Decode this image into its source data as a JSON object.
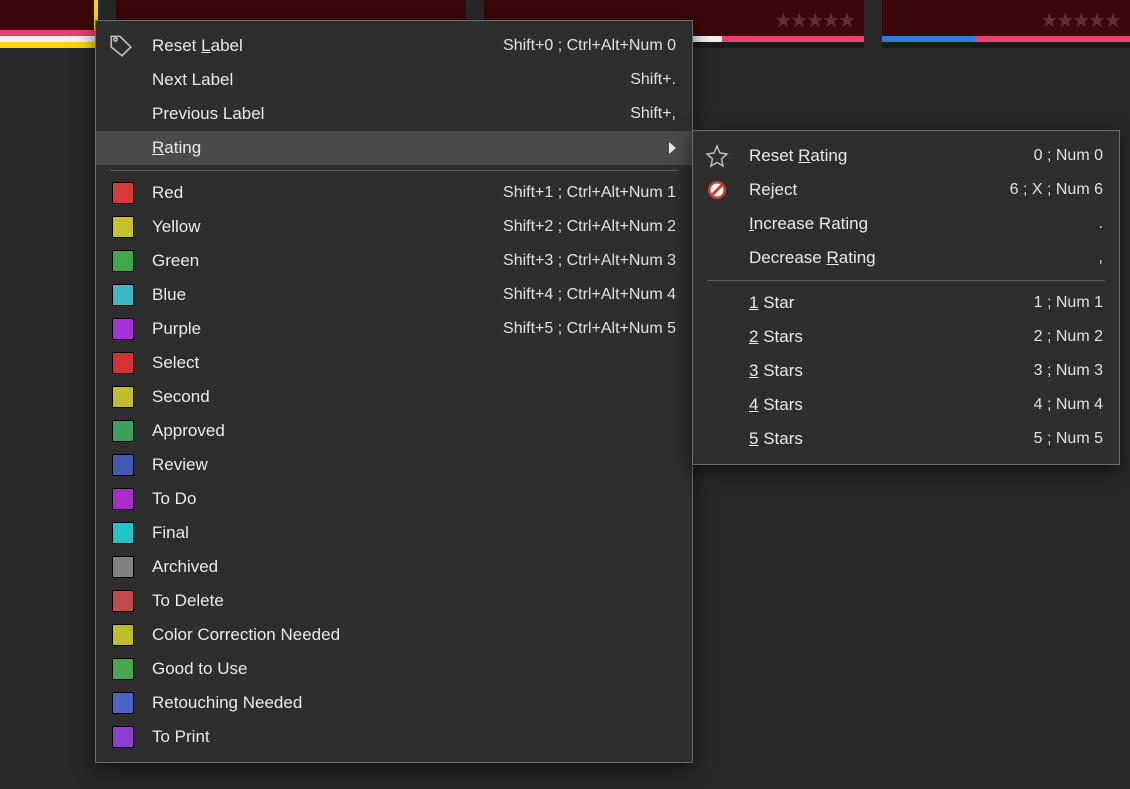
{
  "menu": {
    "header": [
      {
        "label": "Reset Label",
        "ul_start": 6,
        "shortcut": "Shift+0 ; Ctrl+Alt+Num 0"
      },
      {
        "label": "Next Label",
        "shortcut": "Shift+."
      },
      {
        "label": "Previous Label",
        "shortcut": "Shift+,"
      }
    ],
    "rating_label": "Rating",
    "colors": [
      {
        "name": "Red",
        "hex": "#d83a36",
        "shortcut": "Shift+1 ; Ctrl+Alt+Num 1"
      },
      {
        "name": "Yellow",
        "hex": "#c7c22a",
        "shortcut": "Shift+2 ; Ctrl+Alt+Num 2"
      },
      {
        "name": "Green",
        "hex": "#3fa64a",
        "shortcut": "Shift+3 ; Ctrl+Alt+Num 3"
      },
      {
        "name": "Blue",
        "hex": "#3fb8c4",
        "shortcut": "Shift+4 ; Ctrl+Alt+Num 4"
      },
      {
        "name": "Purple",
        "hex": "#a631d4",
        "shortcut": "Shift+5 ; Ctrl+Alt+Num 5"
      },
      {
        "name": "Select",
        "hex": "#d33232",
        "shortcut": ""
      },
      {
        "name": "Second",
        "hex": "#bfbf2a",
        "shortcut": ""
      },
      {
        "name": "Approved",
        "hex": "#3aa05a",
        "shortcut": ""
      },
      {
        "name": "Review",
        "hex": "#3f5bb0",
        "shortcut": ""
      },
      {
        "name": "To Do",
        "hex": "#a82ec7",
        "shortcut": ""
      },
      {
        "name": "Final",
        "hex": "#22c4cc",
        "shortcut": ""
      },
      {
        "name": "Archived",
        "hex": "#808080",
        "shortcut": ""
      },
      {
        "name": "To Delete",
        "hex": "#c24a4a",
        "shortcut": ""
      },
      {
        "name": "Color Correction Needed",
        "hex": "#bdbd27",
        "shortcut": ""
      },
      {
        "name": "Good to Use",
        "hex": "#4aa64c",
        "shortcut": ""
      },
      {
        "name": "Retouching Needed",
        "hex": "#4a66c4",
        "shortcut": ""
      },
      {
        "name": "To Print",
        "hex": "#8f3fd0",
        "shortcut": ""
      }
    ]
  },
  "submenu": {
    "top": [
      {
        "label": "Reset Rating",
        "ul_start": 6,
        "shortcut": "0 ; Num 0",
        "icon": "star"
      },
      {
        "label": "Reject",
        "shortcut": "6 ; X ; Num 6",
        "icon": "prohibit"
      },
      {
        "label": "Increase Rating",
        "ul_start": 0,
        "shortcut": "."
      },
      {
        "label": "Decrease Rating",
        "ul_start": 9,
        "shortcut": ","
      }
    ],
    "stars": [
      {
        "label": "1 Star",
        "ul_start": 0,
        "shortcut": "1 ; Num 1"
      },
      {
        "label": "2 Stars",
        "ul_start": 0,
        "shortcut": "2 ; Num 2"
      },
      {
        "label": "3 Stars",
        "ul_start": 0,
        "shortcut": "3 ; Num 3"
      },
      {
        "label": "4 Stars",
        "ul_start": 0,
        "shortcut": "4 ; Num 4"
      },
      {
        "label": "5 Stars",
        "ul_start": 0,
        "shortcut": "5 ; Num 5"
      }
    ]
  },
  "filmstrip": {
    "accent_yellow": "#ffd400",
    "accent_pink": "#e4416e",
    "accent_white": "#f0f0f0",
    "accent_blue": "#2d7ed8",
    "dark_red": "#4a0a0a"
  }
}
